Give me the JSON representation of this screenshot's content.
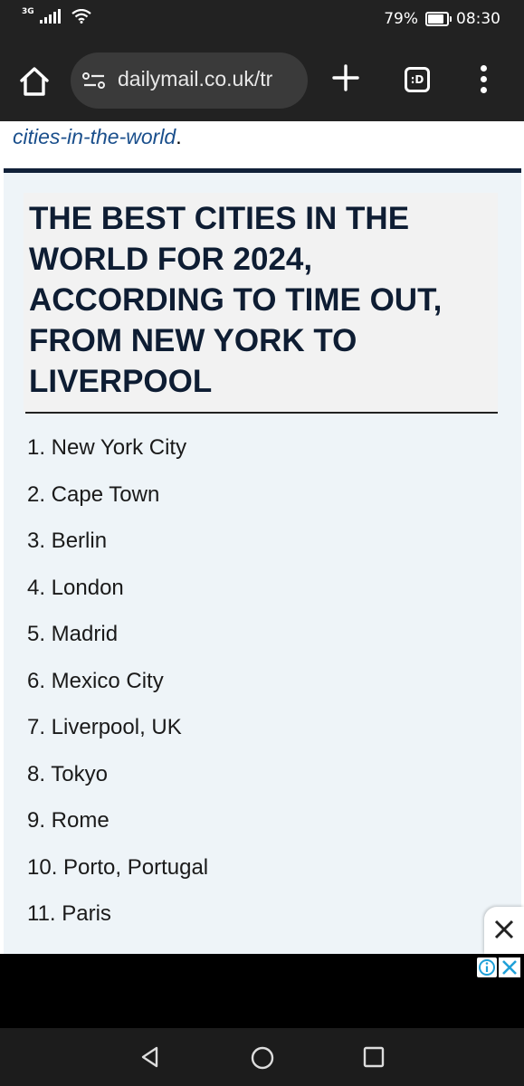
{
  "status_bar": {
    "network": "3G",
    "battery_percent": "79%",
    "battery_level": 0.79,
    "time": "08:30"
  },
  "browser": {
    "url": "dailymail.co.uk/tr",
    "tab_icon_label": ":D",
    "icons": [
      "home-icon",
      "site-settings-icon",
      "new-tab-icon",
      "tab-switcher-icon",
      "menu-icon"
    ]
  },
  "article": {
    "previous_link": "cities-in-the-world",
    "previous_link_suffix": ".",
    "list_title": "THE BEST CITIES IN THE WORLD FOR 2024, ACCORDING TO TIME OUT, FROM NEW YORK TO LIVERPOOL",
    "cities": [
      "1. New York City",
      "2. Cape Town",
      "3. Berlin",
      "4. London",
      "5. Madrid",
      "6. Mexico City",
      "7. Liverpool, UK",
      "8. Tokyo",
      "9. Rome",
      "10. Porto, Portugal",
      "11. Paris"
    ]
  },
  "colors": {
    "title_navy": "#0e1d33",
    "link_blue": "#1a4f8c",
    "panel_bg": "#eef4f8",
    "adchoices_blue": "#1fa0d8"
  }
}
